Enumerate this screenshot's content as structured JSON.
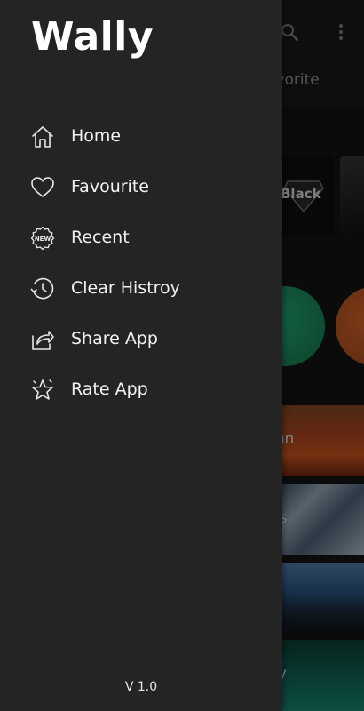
{
  "app": {
    "title": "Wally",
    "version": "V 1.0"
  },
  "drawer": {
    "items": [
      {
        "label": "Home",
        "icon": "home-icon"
      },
      {
        "label": "Favourite",
        "icon": "heart-icon"
      },
      {
        "label": "Recent",
        "icon": "new-badge-icon"
      },
      {
        "label": "Clear Histroy",
        "icon": "history-icon"
      },
      {
        "label": "Share App",
        "icon": "share-icon"
      },
      {
        "label": "Rate App",
        "icon": "star-icon"
      }
    ]
  },
  "background": {
    "tab_fragment": "avorite",
    "cards": [
      {
        "label": "Black"
      }
    ],
    "tiles": [
      {
        "label": "mn"
      },
      {
        "label": "gs"
      },
      {
        "label": ""
      },
      {
        "label": "sy"
      }
    ]
  },
  "colors": {
    "drawer_bg": "#242424",
    "text": "#f2f2f2",
    "accent_green": "#1f9d6a",
    "accent_orange": "#d4622a"
  }
}
